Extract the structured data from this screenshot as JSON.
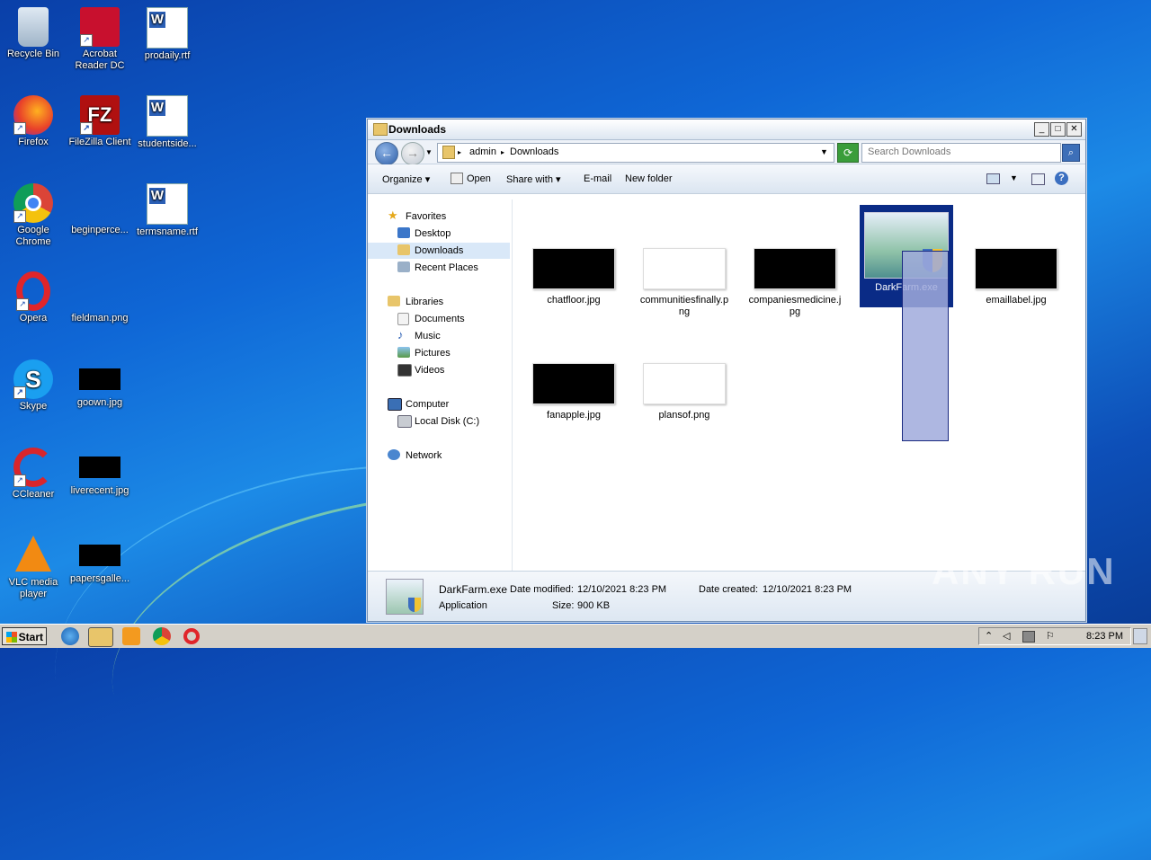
{
  "desktop": {
    "icons": [
      {
        "label": "Recycle Bin"
      },
      {
        "label": "Acrobat Reader DC"
      },
      {
        "label": "prodaily.rtf"
      },
      {
        "label": "Firefox"
      },
      {
        "label": "FileZilla Client"
      },
      {
        "label": "studentside..."
      },
      {
        "label": "Google Chrome"
      },
      {
        "label": "beginperce..."
      },
      {
        "label": "termsname.rtf"
      },
      {
        "label": "Opera"
      },
      {
        "label": "fieldman.png"
      },
      {
        "label": "Skype"
      },
      {
        "label": "goown.jpg"
      },
      {
        "label": "CCleaner"
      },
      {
        "label": "liverecent.jpg"
      },
      {
        "label": "VLC media player"
      },
      {
        "label": "papersgalle..."
      }
    ]
  },
  "window": {
    "title": "Downloads",
    "controls": {
      "minimize": "_",
      "maximize": "□",
      "close": "✕"
    },
    "breadcrumb": [
      "admin",
      "Downloads"
    ],
    "search_placeholder": "Search Downloads",
    "toolbar": {
      "organize": "Organize",
      "open": "Open",
      "share_with": "Share with",
      "email": "E-mail",
      "new_folder": "New folder"
    },
    "nav": {
      "favorites": "Favorites",
      "desktop": "Desktop",
      "downloads": "Downloads",
      "recent_places": "Recent Places",
      "libraries": "Libraries",
      "documents": "Documents",
      "music": "Music",
      "pictures": "Pictures",
      "videos": "Videos",
      "computer": "Computer",
      "local_disk": "Local Disk (C:)",
      "network": "Network"
    },
    "files": [
      {
        "name": "chatfloor.jpg"
      },
      {
        "name": "communitiesfinally.png"
      },
      {
        "name": "companiesmedicine.jpg"
      },
      {
        "name": "DarkFarm.exe"
      },
      {
        "name": "emaillabel.jpg"
      },
      {
        "name": "fanapple.jpg"
      },
      {
        "name": "plansof.png"
      }
    ],
    "details": {
      "name": "DarkFarm.exe",
      "type": "Application",
      "modified_label": "Date modified:",
      "modified_value": "12/10/2021 8:23 PM",
      "size_label": "Size:",
      "size_value": "900 KB",
      "created_label": "Date created:",
      "created_value": "12/10/2021 8:23 PM"
    }
  },
  "taskbar": {
    "start": "Start",
    "clock": "8:23 PM"
  },
  "watermark": "ANY RUN"
}
